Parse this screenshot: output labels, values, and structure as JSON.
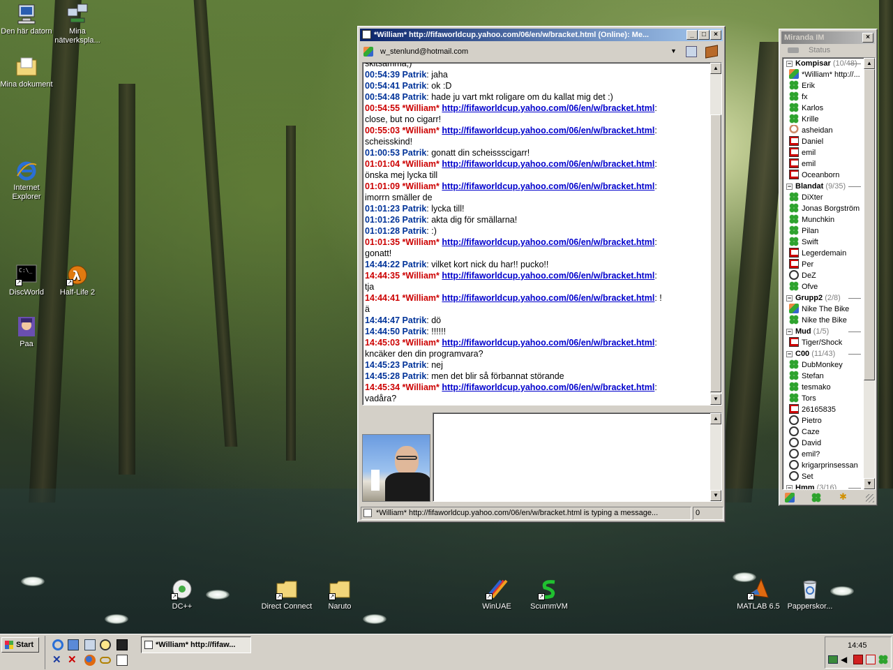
{
  "desktop": {
    "icons": [
      {
        "label": "Den här datorn",
        "icon": "my-computer-icon"
      },
      {
        "label": "Mina nätverkspla...",
        "icon": "network-places-icon"
      },
      {
        "label": "Mina dokument",
        "icon": "my-documents-icon"
      },
      {
        "label": "Internet Explorer",
        "icon": "internet-explorer-icon"
      },
      {
        "label": "DiscWorld",
        "icon": "discworld-icon"
      },
      {
        "label": "Half-Life 2",
        "icon": "half-life-2-icon"
      },
      {
        "label": "Paa",
        "icon": "paa-icon"
      },
      {
        "label": "DC++",
        "icon": "dcpp-icon"
      },
      {
        "label": "Direct Connect",
        "icon": "folder-icon"
      },
      {
        "label": "Naruto",
        "icon": "folder-icon"
      },
      {
        "label": "WinUAE",
        "icon": "winuae-icon"
      },
      {
        "label": "ScummVM",
        "icon": "scummvm-icon"
      },
      {
        "label": "MATLAB 6.5",
        "icon": "matlab-icon"
      },
      {
        "label": "Papperskor...",
        "icon": "recycle-bin-icon"
      }
    ]
  },
  "chat": {
    "title": "*William* http://fifaworldcup.yahoo.com/06/en/w/bracket.html (Online): Me...",
    "account": "w_stenlund@hotmail.com",
    "partial_top": "skitsamma;)",
    "messages": [
      {
        "time": "00:54:39",
        "who": "Patrik",
        "me": true,
        "text": "jaha"
      },
      {
        "time": "00:54:41",
        "who": "Patrik",
        "me": true,
        "text": "ok :D"
      },
      {
        "time": "00:54:48",
        "who": "Patrik",
        "me": true,
        "text": "hade ju vart mkt roligare om du kallat mig det :)"
      },
      {
        "time": "00:54:55",
        "who": "*William*",
        "me": false,
        "link": "http://fifaworldcup.yahoo.com/06/en/w/bracket.html",
        "text": "close, but no cigarr!"
      },
      {
        "time": "00:55:03",
        "who": "*William*",
        "me": false,
        "link": "http://fifaworldcup.yahoo.com/06/en/w/bracket.html",
        "text": "scheisskind!"
      },
      {
        "time": "01:00:53",
        "who": "Patrik",
        "me": true,
        "text": "gonatt din scheissscigarr!"
      },
      {
        "time": "01:01:04",
        "who": "*William*",
        "me": false,
        "link": "http://fifaworldcup.yahoo.com/06/en/w/bracket.html",
        "text": "önska mej lycka till"
      },
      {
        "time": "01:01:09",
        "who": "*William*",
        "me": false,
        "link": "http://fifaworldcup.yahoo.com/06/en/w/bracket.html",
        "text": "imorrn smäller de"
      },
      {
        "time": "01:01:23",
        "who": "Patrik",
        "me": true,
        "text": "lycka till!"
      },
      {
        "time": "01:01:26",
        "who": "Patrik",
        "me": true,
        "text": "akta dig för smällarna!"
      },
      {
        "time": "01:01:28",
        "who": "Patrik",
        "me": true,
        "text": ":)"
      },
      {
        "time": "01:01:35",
        "who": "*William*",
        "me": false,
        "link": "http://fifaworldcup.yahoo.com/06/en/w/bracket.html",
        "text": "gonatt!"
      },
      {
        "time": "14:44:22",
        "who": "Patrik",
        "me": true,
        "text": "vilket kort nick du har!! pucko!!"
      },
      {
        "time": "14:44:35",
        "who": "*William*",
        "me": false,
        "link": "http://fifaworldcup.yahoo.com/06/en/w/bracket.html",
        "text": "tja"
      },
      {
        "time": "14:44:41",
        "who": "*William*",
        "me": false,
        "link": "http://fifaworldcup.yahoo.com/06/en/w/bracket.html",
        "text": "ä",
        "suffix": " !"
      },
      {
        "time": "14:44:47",
        "who": "Patrik",
        "me": true,
        "text": "dö"
      },
      {
        "time": "14:44:50",
        "who": "Patrik",
        "me": true,
        "text": "!!!!!!"
      },
      {
        "time": "14:45:03",
        "who": "*William*",
        "me": false,
        "link": "http://fifaworldcup.yahoo.com/06/en/w/bracket.html",
        "text": "kncäker den din programvara?"
      },
      {
        "time": "14:45:23",
        "who": "Patrik",
        "me": true,
        "text": "nej"
      },
      {
        "time": "14:45:28",
        "who": "Patrik",
        "me": true,
        "text": "men det blir så förbannat störande"
      },
      {
        "time": "14:45:34",
        "who": "*William*",
        "me": false,
        "link": "http://fifaworldcup.yahoo.com/06/en/w/bracket.html",
        "text": "vadåra?"
      }
    ],
    "status_text": "*William* http://fifaworldcup.yahoo.com/06/en/w/bracket.html is typing a message...",
    "char_count": "0",
    "input_value": ""
  },
  "miranda": {
    "title": "Miranda IM",
    "status_label": "Status",
    "rows": [
      {
        "type": "group",
        "name": "Kompisar",
        "count": "(10/48)"
      },
      {
        "type": "contact",
        "name": "*William* http://...",
        "icon": "msn"
      },
      {
        "type": "contact",
        "name": "Erik",
        "icon": "clover"
      },
      {
        "type": "contact",
        "name": "fx",
        "icon": "clover"
      },
      {
        "type": "contact",
        "name": "Karlos",
        "icon": "clover"
      },
      {
        "type": "contact",
        "name": "Krille",
        "icon": "clover"
      },
      {
        "type": "contact",
        "name": "asheidan",
        "icon": "away"
      },
      {
        "type": "contact",
        "name": "Daniel",
        "icon": "pc"
      },
      {
        "type": "contact",
        "name": "emil",
        "icon": "pc"
      },
      {
        "type": "contact",
        "name": "emil",
        "icon": "pc"
      },
      {
        "type": "contact",
        "name": "Oceanborn",
        "icon": "pc"
      },
      {
        "type": "group",
        "name": "Blandat",
        "count": "(9/35)"
      },
      {
        "type": "contact",
        "name": "DiXter",
        "icon": "clover"
      },
      {
        "type": "contact",
        "name": "Jonas Borgström",
        "icon": "clover"
      },
      {
        "type": "contact",
        "name": "Munchkin",
        "icon": "clover"
      },
      {
        "type": "contact",
        "name": "Pilan",
        "icon": "clover"
      },
      {
        "type": "contact",
        "name": "Swift",
        "icon": "clover"
      },
      {
        "type": "contact",
        "name": "Legerdemain",
        "icon": "pc"
      },
      {
        "type": "contact",
        "name": "Per",
        "icon": "pc"
      },
      {
        "type": "contact",
        "name": "DeZ",
        "icon": "clock"
      },
      {
        "type": "contact",
        "name": "Ofve",
        "icon": "clover"
      },
      {
        "type": "group",
        "name": "Grupp2",
        "count": "(2/8)"
      },
      {
        "type": "contact",
        "name": "Nike The Bike",
        "icon": "msn"
      },
      {
        "type": "contact",
        "name": "Nike the Bike",
        "icon": "clover"
      },
      {
        "type": "group",
        "name": "Mud",
        "count": "(1/5)"
      },
      {
        "type": "contact",
        "name": "Tiger/Shock",
        "icon": "pc"
      },
      {
        "type": "group",
        "name": "C00",
        "count": "(11/43)"
      },
      {
        "type": "contact",
        "name": "DubMonkey",
        "icon": "clover"
      },
      {
        "type": "contact",
        "name": "Stefan",
        "icon": "clover"
      },
      {
        "type": "contact",
        "name": "tesmako",
        "icon": "clover"
      },
      {
        "type": "contact",
        "name": "Tors",
        "icon": "clover"
      },
      {
        "type": "contact",
        "name": "26165835",
        "icon": "pc"
      },
      {
        "type": "contact",
        "name": "Pietro",
        "icon": "clock"
      },
      {
        "type": "contact",
        "name": "Caze",
        "icon": "clock"
      },
      {
        "type": "contact",
        "name": "David",
        "icon": "clock"
      },
      {
        "type": "contact",
        "name": "emil?",
        "icon": "clock"
      },
      {
        "type": "contact",
        "name": "krigarprinsessan",
        "icon": "clock"
      },
      {
        "type": "contact",
        "name": "Set",
        "icon": "clock"
      },
      {
        "type": "group",
        "name": "Hmm",
        "count": "(3/16)"
      }
    ]
  },
  "taskbar": {
    "start_label": "Start",
    "task_label": "*William* http://fifaw...",
    "clock": "14:45"
  }
}
